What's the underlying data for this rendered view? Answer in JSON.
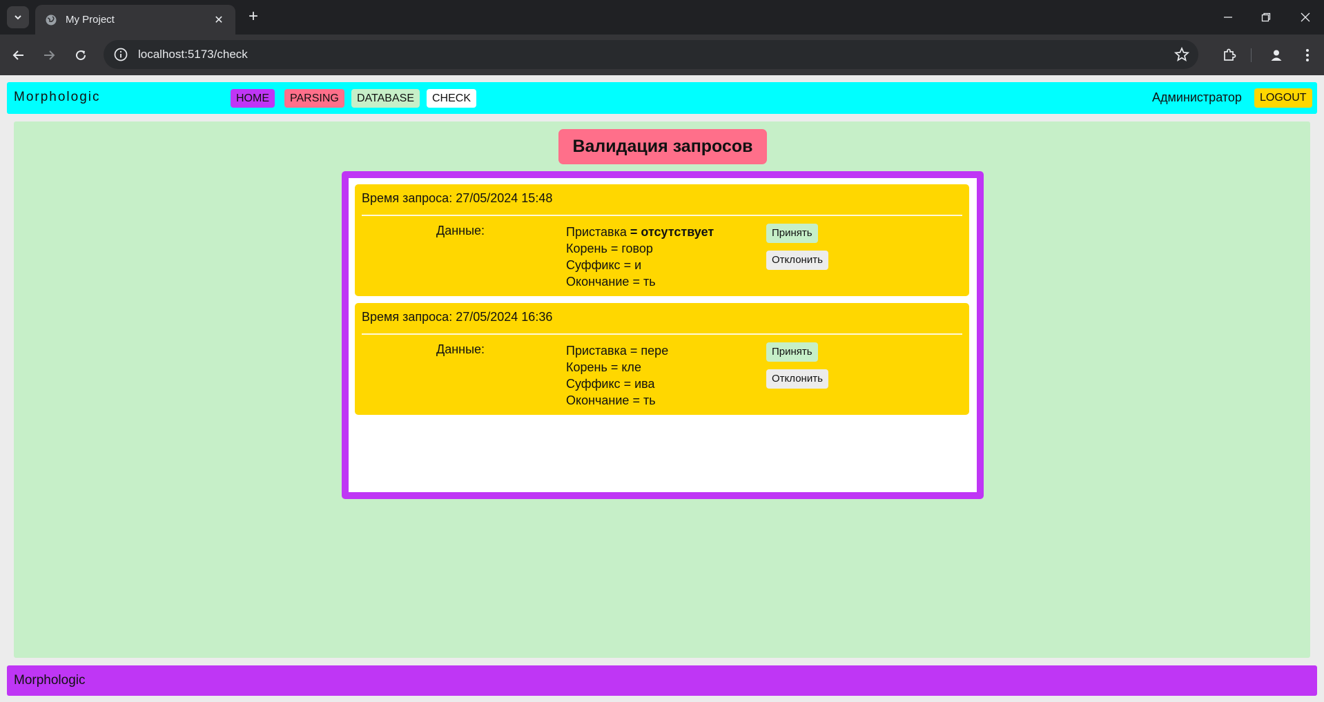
{
  "browser": {
    "tab_title": "My Project",
    "url": "localhost:5173/check"
  },
  "header": {
    "brand": "Morphologic",
    "nav": [
      {
        "label": "HOME",
        "color": "#bf36f5"
      },
      {
        "label": "PARSING",
        "color": "#ff6f8a"
      },
      {
        "label": "DATABASE",
        "color": "#c6efc8"
      },
      {
        "label": "CHECK",
        "color": "#ffffff"
      }
    ],
    "user": "Администратор",
    "logout": {
      "label": "LOGOUT",
      "color": "#ffd700"
    }
  },
  "main": {
    "title": "Валидация запросов",
    "title_color": "#ff6f8a",
    "box_border_color": "#bf36f5",
    "card_color": "#ffd700",
    "time_label": "Время запроса:",
    "data_label": "Данные:",
    "accept_label": "Принять",
    "accept_color": "#c6efc8",
    "reject_label": "Отклонить",
    "reject_color": "#ececec",
    "requests": [
      {
        "time": "27/05/2024 15:48",
        "fields": [
          {
            "name": "Приставка",
            "value": "отсутствует",
            "bold_value": true
          },
          {
            "name": "Корень",
            "value": "говор",
            "bold_value": false
          },
          {
            "name": "Суффикс",
            "value": "и",
            "bold_value": false
          },
          {
            "name": "Окончание",
            "value": "ть",
            "bold_value": false
          }
        ]
      },
      {
        "time": "27/05/2024 16:36",
        "fields": [
          {
            "name": "Приставка",
            "value": "пере",
            "bold_value": false
          },
          {
            "name": "Корень",
            "value": "кле",
            "bold_value": false
          },
          {
            "name": "Суффикс",
            "value": "ива",
            "bold_value": false
          },
          {
            "name": "Окончание",
            "value": "ть",
            "bold_value": false
          }
        ]
      }
    ]
  },
  "footer": {
    "text": "Morphologic"
  }
}
